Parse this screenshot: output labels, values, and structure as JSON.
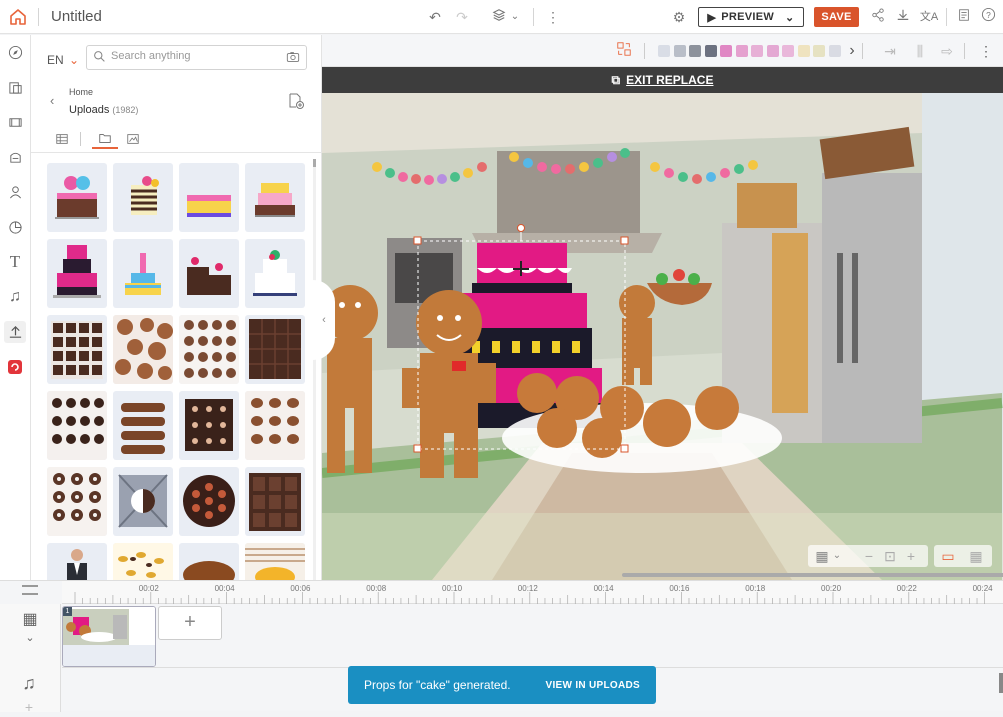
{
  "app": {
    "title": "Untitled"
  },
  "toolbar": {
    "preview_label": "PREVIEW",
    "save_label": "SAVE"
  },
  "library": {
    "language": "EN",
    "search_placeholder": "Search anything",
    "breadcrumb_home": "Home",
    "folder_name": "Uploads",
    "folder_count": "(1982)"
  },
  "canvas": {
    "exit_replace_label": "EXIT REPLACE",
    "palette": [
      "#d9dde6",
      "#b9bec8",
      "#8d929c",
      "#6c7180",
      "#e087c4",
      "#e5a1cf",
      "#e7b0d6",
      "#e4a8d3",
      "#e9b7da",
      "#efe3bf",
      "#e6e2c2",
      "#d9dbe3"
    ]
  },
  "timeline": {
    "ticks": [
      "00:02",
      "00:04",
      "00:06",
      "00:08",
      "00:10",
      "00:12",
      "00:14",
      "00:16",
      "00:18",
      "00:20",
      "00:22",
      "00:24"
    ],
    "scene_number": "1"
  },
  "toast": {
    "message": "Props for \"cake\" generated.",
    "action": "VIEW IN UPLOADS"
  }
}
